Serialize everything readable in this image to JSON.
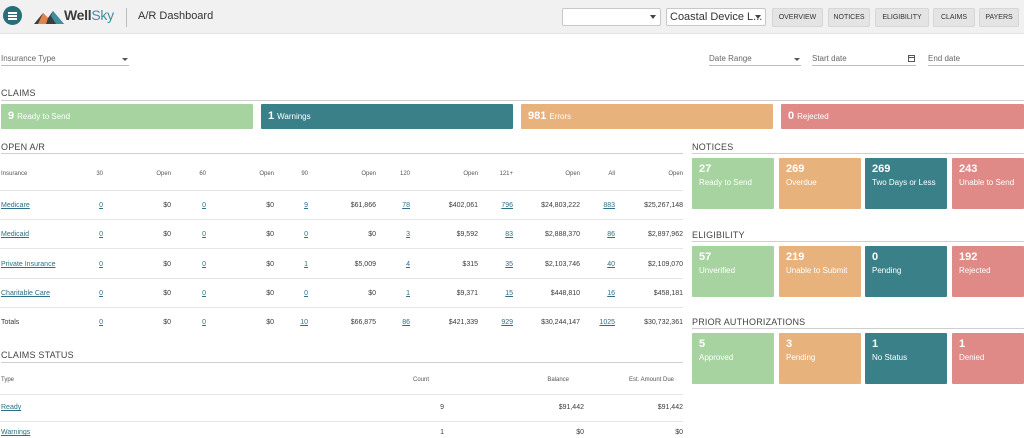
{
  "header": {
    "brand_main": "Well",
    "brand_accent": "Sky",
    "app_title": "A/R Dashboard",
    "select_blank": "",
    "location_select": "Coastal Device L...",
    "nav": [
      "OVERVIEW",
      "NOTICES",
      "ELIGIBILITY",
      "CLAIMS",
      "PAYERS"
    ]
  },
  "filters": {
    "insurance_type": "Insurance Type",
    "date_range": "Date Range",
    "start_date": "Start date",
    "end_date": "End date"
  },
  "claims": {
    "title": "CLAIMS",
    "cards": [
      {
        "count": "9",
        "label": "Ready to Send",
        "color": "green"
      },
      {
        "count": "1",
        "label": "Warnings",
        "color": "teal"
      },
      {
        "count": "981",
        "label": "Errors",
        "color": "orange"
      },
      {
        "count": "0",
        "label": "Rejected",
        "color": "red"
      }
    ]
  },
  "open_ar": {
    "title": "OPEN A/R",
    "headers": [
      "Insurance",
      "30",
      "Open",
      "60",
      "Open",
      "90",
      "Open",
      "120",
      "Open",
      "121+",
      "Open",
      "All",
      "Open"
    ],
    "rows": [
      {
        "name": "Medicare",
        "link": true,
        "vals": [
          "0",
          "$0",
          "0",
          "$0",
          "9",
          "$61,866",
          "78",
          "$402,061",
          "796",
          "$24,803,222",
          "883",
          "$25,267,148"
        ]
      },
      {
        "name": "Medicaid",
        "link": true,
        "vals": [
          "0",
          "$0",
          "0",
          "$0",
          "0",
          "$0",
          "3",
          "$9,592",
          "83",
          "$2,888,370",
          "86",
          "$2,897,962"
        ]
      },
      {
        "name": "Private Insurance",
        "link": true,
        "vals": [
          "0",
          "$0",
          "0",
          "$0",
          "1",
          "$5,009",
          "4",
          "$315",
          "35",
          "$2,103,746",
          "40",
          "$2,109,070"
        ]
      },
      {
        "name": "Charitable Care",
        "link": true,
        "vals": [
          "0",
          "$0",
          "0",
          "$0",
          "0",
          "$0",
          "1",
          "$9,371",
          "15",
          "$448,810",
          "16",
          "$458,181"
        ]
      },
      {
        "name": "Totals",
        "link": false,
        "vals": [
          "0",
          "$0",
          "0",
          "$0",
          "10",
          "$66,875",
          "86",
          "$421,339",
          "929",
          "$30,244,147",
          "1025",
          "$30,732,361"
        ]
      }
    ]
  },
  "claims_status": {
    "title": "CLAIMS STATUS",
    "headers": [
      "Type",
      "Count",
      "Balance",
      "Est. Amount Due"
    ],
    "rows": [
      {
        "type": "Ready",
        "count": "9",
        "balance": "$91,442",
        "due": "$91,442"
      },
      {
        "type": "Warnings",
        "count": "1",
        "balance": "$0",
        "due": "$0"
      }
    ]
  },
  "notices": {
    "title": "NOTICES",
    "cards": [
      {
        "count": "27",
        "label": "Ready to Send",
        "color": "green"
      },
      {
        "count": "269",
        "label": "Overdue",
        "color": "orange"
      },
      {
        "count": "269",
        "label": "Two Days or Less",
        "color": "teal"
      },
      {
        "count": "243",
        "label": "Unable to Send",
        "color": "red"
      }
    ]
  },
  "eligibility": {
    "title": "ELIGIBILITY",
    "cards": [
      {
        "count": "57",
        "label": "Unverified",
        "color": "green"
      },
      {
        "count": "219",
        "label": "Unable to Submit",
        "color": "orange"
      },
      {
        "count": "0",
        "label": "Pending",
        "color": "teal"
      },
      {
        "count": "192",
        "label": "Rejected",
        "color": "red"
      }
    ]
  },
  "prior_auth": {
    "title": "PRIOR AUTHORIZATIONS",
    "cards": [
      {
        "count": "5",
        "label": "Approved",
        "color": "green"
      },
      {
        "count": "3",
        "label": "Pending",
        "color": "orange"
      },
      {
        "count": "1",
        "label": "No Status",
        "color": "teal"
      },
      {
        "count": "1",
        "label": "Denied",
        "color": "red"
      }
    ]
  }
}
